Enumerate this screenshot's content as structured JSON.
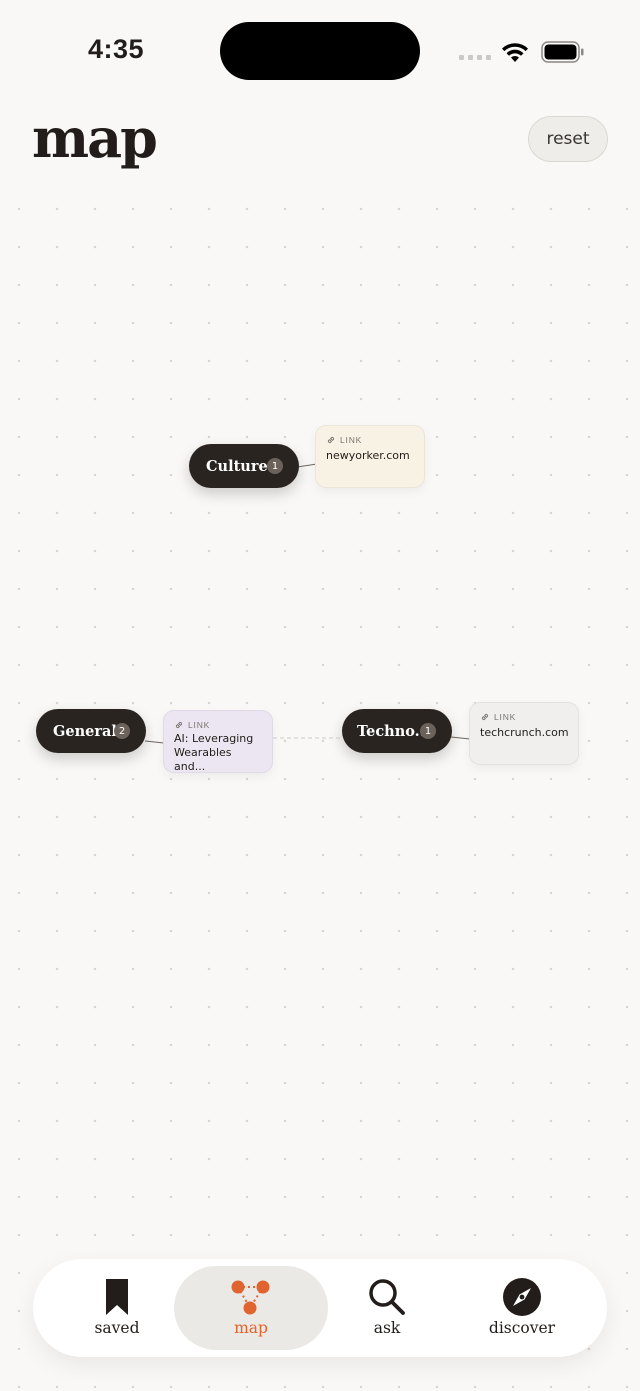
{
  "status_bar": {
    "time": "4:35"
  },
  "header": {
    "title": "map",
    "reset_label": "reset"
  },
  "graph": {
    "topics": [
      {
        "name": "Culture",
        "count": "1"
      },
      {
        "name": "General",
        "count": "2"
      },
      {
        "name": "Techno...",
        "count": "1"
      }
    ],
    "cards": [
      {
        "kind": "LINK",
        "title": "newyorker.com",
        "color": "#f7f2e3"
      },
      {
        "kind": "LINK",
        "title": "AI: Leveraging Wearables and...",
        "color": "#ece6f2"
      },
      {
        "kind": "LINK",
        "title": "techcrunch.com",
        "color": "#f0efee"
      }
    ]
  },
  "tabbar": {
    "active_color": "#e0642f",
    "tabs": [
      {
        "label": "saved",
        "icon": "bookmark-icon"
      },
      {
        "label": "map",
        "icon": "graph-nodes-icon"
      },
      {
        "label": "ask",
        "icon": "search-icon"
      },
      {
        "label": "discover",
        "icon": "compass-icon"
      }
    ]
  }
}
